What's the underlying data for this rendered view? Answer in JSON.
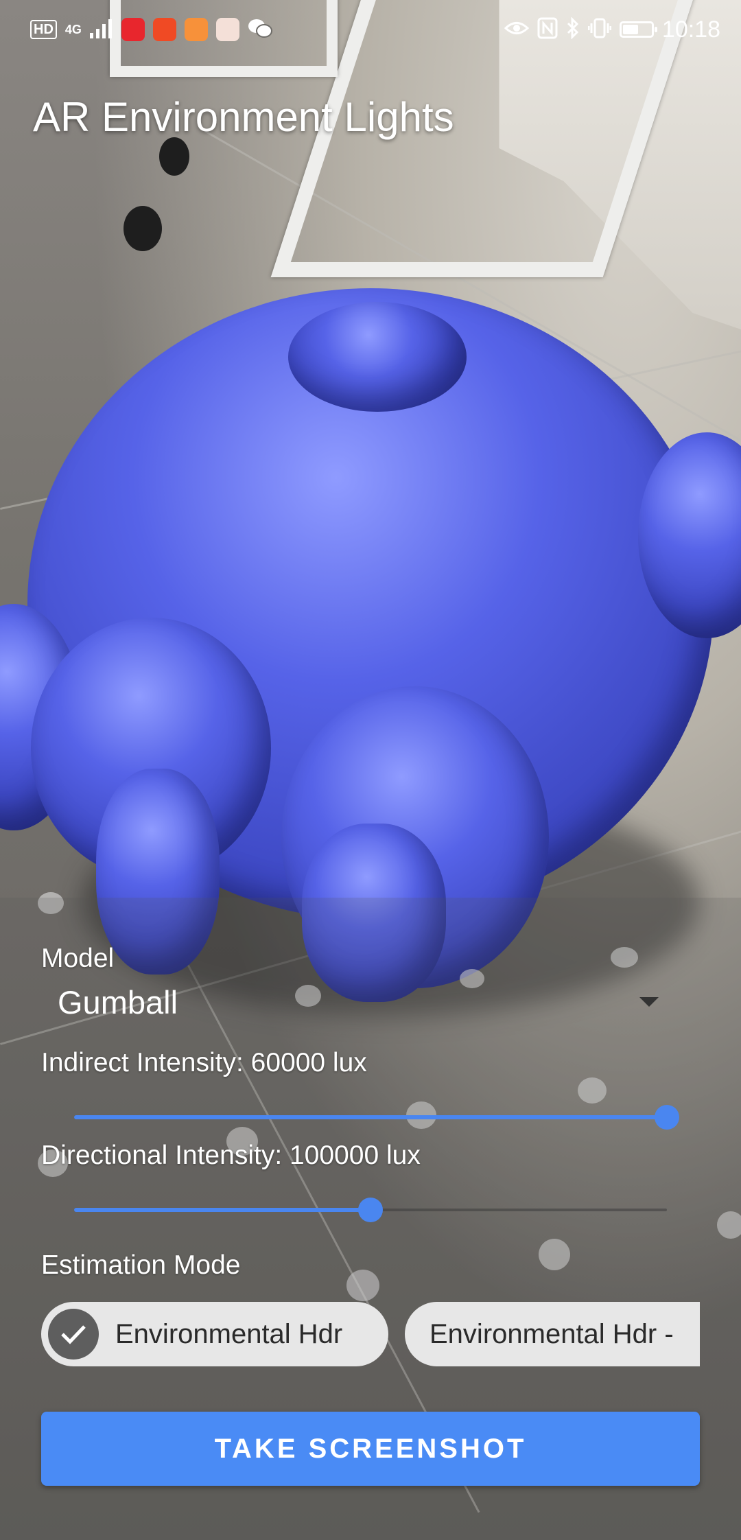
{
  "status_bar": {
    "hd": "HD",
    "network": "4G",
    "time": "10:18",
    "battery_level": 0.55,
    "left_icons": [
      "signal-icon",
      "video-app-icon",
      "news-app-icon",
      "player-app-icon",
      "box-app-icon",
      "wechat-icon"
    ],
    "right_icons": [
      "eye-comfort-icon",
      "nfc-icon",
      "bluetooth-icon",
      "vibrate-icon",
      "battery-icon"
    ]
  },
  "app": {
    "title": "AR Environment Lights"
  },
  "model_select": {
    "label": "Model",
    "value": "Gumball"
  },
  "indirect": {
    "label": "Indirect Intensity: 60000 lux",
    "fraction": 1.0
  },
  "directional": {
    "label": "Directional Intensity: 100000 lux",
    "fraction": 0.5
  },
  "estimation": {
    "label": "Estimation Mode",
    "chips": [
      {
        "label": "Environmental Hdr",
        "selected": true
      },
      {
        "label": "Environmental Hdr -",
        "selected": false
      }
    ]
  },
  "actions": {
    "screenshot_label": "TAKE SCREENSHOT"
  },
  "colors": {
    "accent": "#4a8bf5",
    "model_blue": "#5663e8"
  }
}
